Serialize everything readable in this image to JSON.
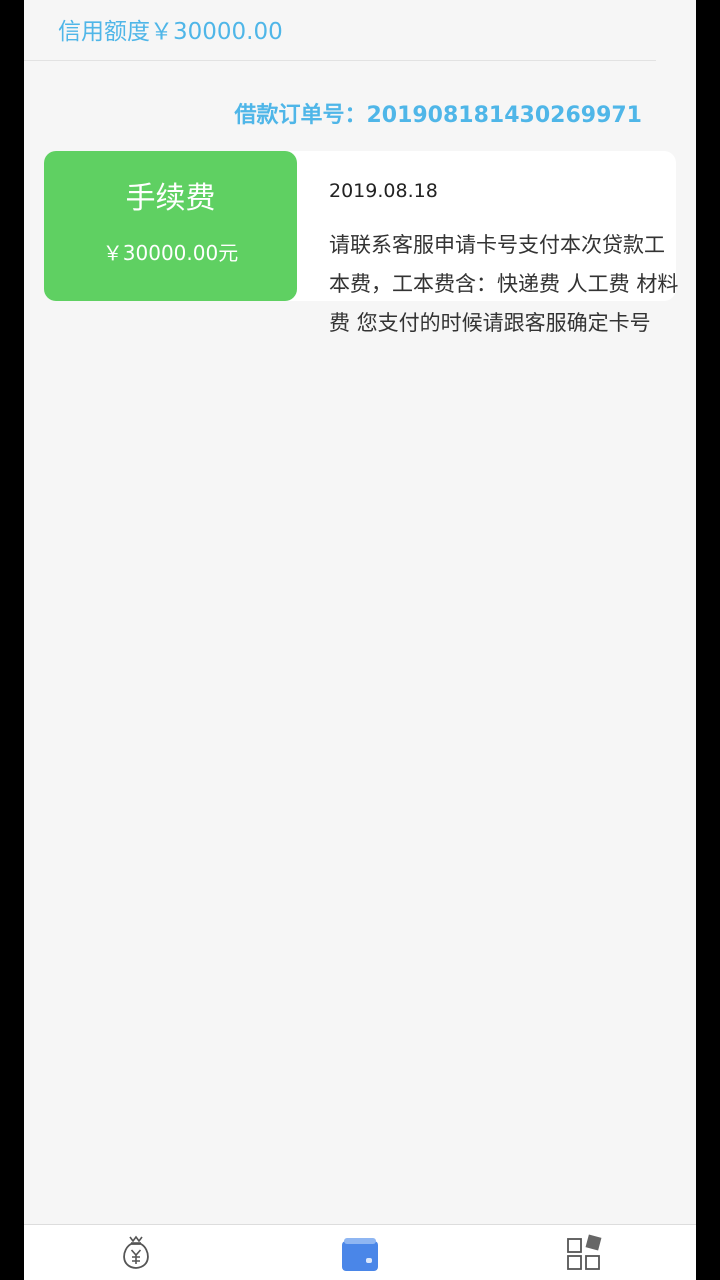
{
  "header": {
    "credit_limit": "信用额度￥30000.00",
    "order_number": "借款订单号：201908181430269971"
  },
  "record": {
    "fee_title": "手续费",
    "fee_amount": "￥30000.00元",
    "date": "2019.08.18",
    "description": "请联系客服申请卡号支付本次贷款工本费，工本费含：快递费 人工费 材料费 您支付的时候请跟客服确定卡号"
  },
  "tabbar": {
    "active_index": 1,
    "tabs": [
      {
        "icon": "money-bag-icon",
        "label": ""
      },
      {
        "icon": "wallet-icon",
        "label": ""
      },
      {
        "icon": "grid-apps-icon",
        "label": ""
      }
    ]
  },
  "colors": {
    "accent_blue": "#4fb6e8",
    "fee_green": "#5fd062",
    "active_tab_blue": "#3f7fe8"
  }
}
